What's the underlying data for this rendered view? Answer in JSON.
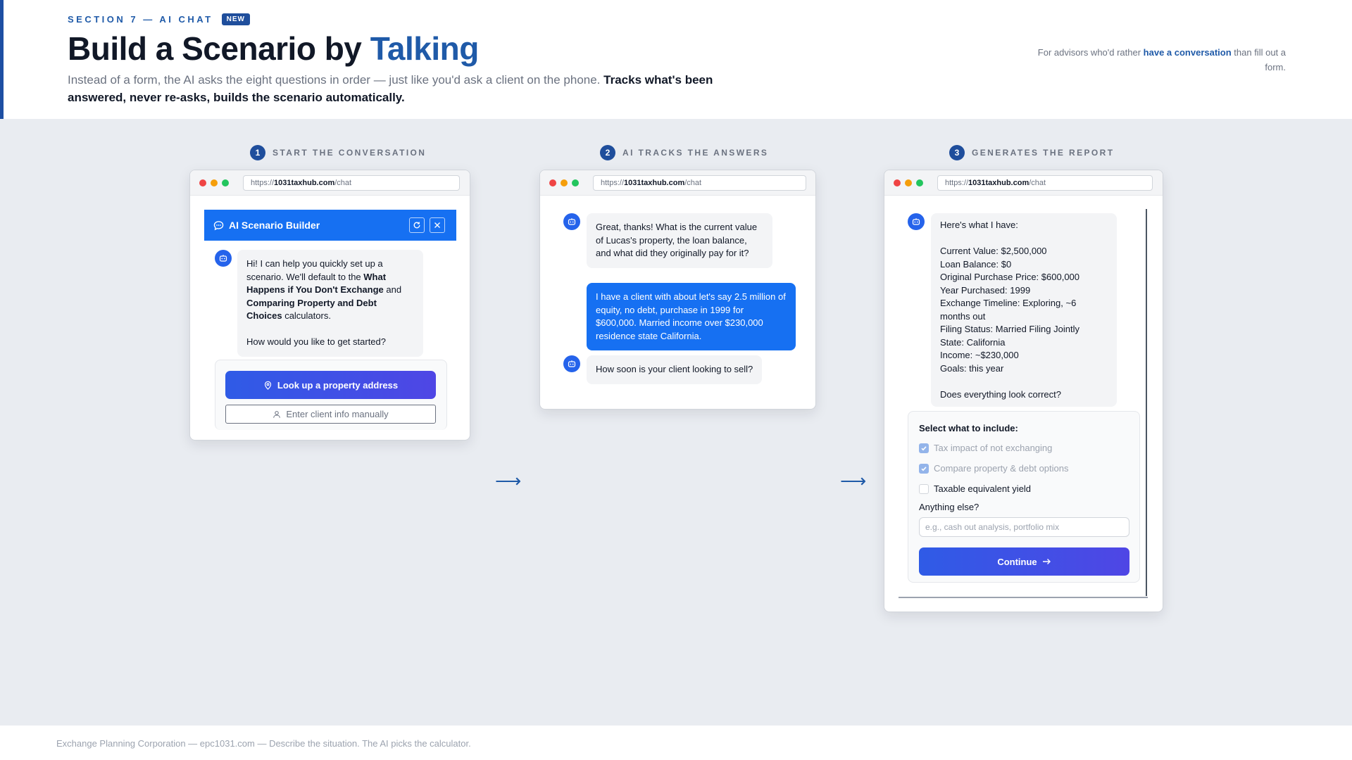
{
  "header": {
    "eyebrow": "SECTION 7 — AI CHAT",
    "badge": "NEW",
    "title_main": "Build a Scenario by ",
    "title_accent": "Talking",
    "subtitle_plain": "Instead of a form, the AI asks the eight questions in order — just like you'd ask a client on the phone. ",
    "subtitle_bold": "Tracks what's been answered, never re-asks, builds the scenario automatically.",
    "aside_pre": "For advisors who'd rather ",
    "aside_bold": "have a conversation",
    "aside_post": " than fill out a form."
  },
  "browser": {
    "url_prefix": "https://",
    "url_domain": "1031taxhub.com",
    "url_path": "/chat"
  },
  "steps": [
    {
      "num": "1",
      "label": "START THE CONVERSATION"
    },
    {
      "num": "2",
      "label": "AI TRACKS THE ANSWERS"
    },
    {
      "num": "3",
      "label": "GENERATES THE REPORT"
    }
  ],
  "window1": {
    "widget_title": "AI Scenario Builder",
    "msg_p1": "Hi! I can help you quickly set up a scenario. We'll default to the ",
    "msg_b1": "What Happens if You Don't Exchange",
    "msg_p2": " and ",
    "msg_b2": "Comparing Property and Debt Choices",
    "msg_p3": " calculators.",
    "msg_p4": "How would you like to get started?",
    "btn_lookup": "Look up a property address",
    "btn_manual": "Enter client info manually"
  },
  "window2": {
    "bot_msg_1": "Great, thanks! What is the current value of Lucas's property, the loan balance, and what did they originally pay for it?",
    "user_msg": "I have a client with about let's say 2.5 million of equity, no debt, purchase in 1999 for $600,000. Married income over $230,000 residence state California.",
    "bot_msg_2": "How soon is your client looking to sell?"
  },
  "window3": {
    "summary_intro": "Here's what I have:",
    "summary_lines": [
      "Current Value: $2,500,000",
      "Loan Balance: $0",
      "Original Purchase Price: $600,000",
      "Year Purchased: 1999",
      "Exchange Timeline: Exploring, ~6 months out",
      "Filing Status: Married Filing Jointly",
      "State: California",
      "Income: ~$230,000",
      "Goals: this year"
    ],
    "summary_question": "Does everything look correct?",
    "panel_title": "Select what to include:",
    "options": [
      {
        "label": "Tax impact of not exchanging",
        "checked": true
      },
      {
        "label": "Compare property & debt options",
        "checked": true
      },
      {
        "label": "Taxable equivalent yield",
        "checked": false
      }
    ],
    "else_label": "Anything else?",
    "else_placeholder": "e.g., cash out analysis, portfolio mix",
    "continue_label": "Continue"
  },
  "footer": {
    "text": "Exchange Planning Corporation — epc1031.com — Describe the situation. The AI picks the calculator."
  },
  "colors": {
    "brand": "#1f5aa8",
    "chat_blue": "#1670f2",
    "button_gradient_start": "#2f5be6",
    "button_gradient_end": "#4f46e5"
  },
  "icons": [
    "chat-bubble-icon",
    "refresh-icon",
    "close-icon",
    "bot-icon",
    "map-pin-icon",
    "user-icon",
    "arrow-right-icon"
  ]
}
